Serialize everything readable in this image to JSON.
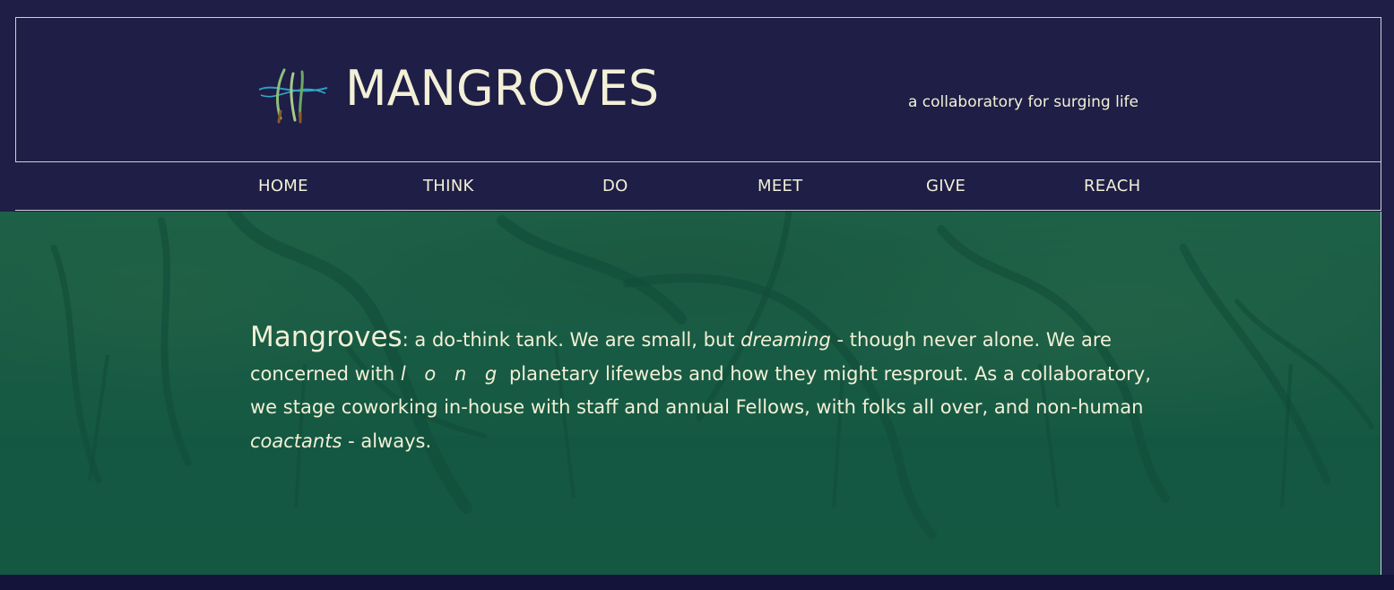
{
  "header": {
    "title": "MANGROVES",
    "tagline": "a collaboratory for surging life",
    "logo_icon": "mangrove-roots-logo"
  },
  "nav": {
    "items": [
      {
        "label": "HOME"
      },
      {
        "label": "THINK"
      },
      {
        "label": "DO"
      },
      {
        "label": "MEET"
      },
      {
        "label": "GIVE"
      },
      {
        "label": "REACH"
      }
    ]
  },
  "hero": {
    "lead": "Mangroves",
    "text_1": ": a do-think tank. We are small, but ",
    "em_1": "dreaming",
    "text_2": " - though never alone. We are concerned with ",
    "em_2": "l o n g",
    "text_3": " planetary lifewebs and how they might resprout. As a collaboratory, we stage coworking in-house with staff and annual Fellows, with folks all over, and non-human ",
    "em_3": "coactants",
    "text_4": " - always."
  },
  "colors": {
    "background": "#1e1e46",
    "text": "#f2f0d6",
    "hero_tint": "#1a5a44"
  }
}
